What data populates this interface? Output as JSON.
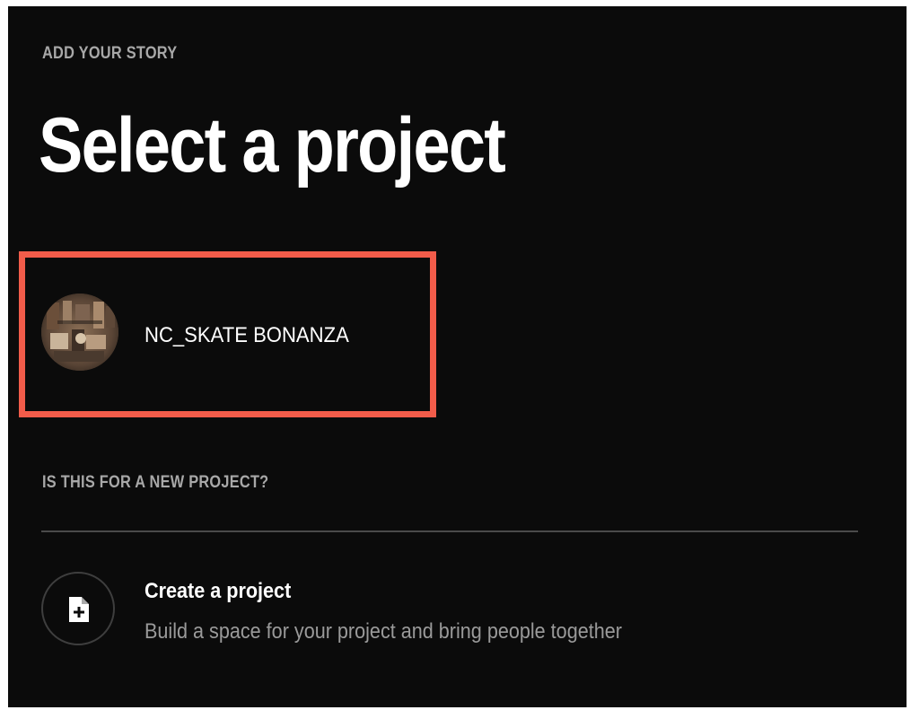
{
  "header": {
    "kicker": "ADD YOUR STORY",
    "title": "Select a project"
  },
  "projects": [
    {
      "name": "NC_SKATE BONANZA",
      "avatar_icon": "project-photo-avatar",
      "highlight_color": "#f25c4a"
    }
  ],
  "new_project": {
    "kicker": "IS THIS FOR A NEW PROJECT?",
    "create_title": "Create a project",
    "create_description": "Build a space for your project and bring people together",
    "icon": "add-document-icon"
  },
  "colors": {
    "background": "#0b0b0b",
    "text_primary": "#ffffff",
    "text_muted": "#a8a8a8",
    "accent_highlight": "#f25c4a"
  }
}
